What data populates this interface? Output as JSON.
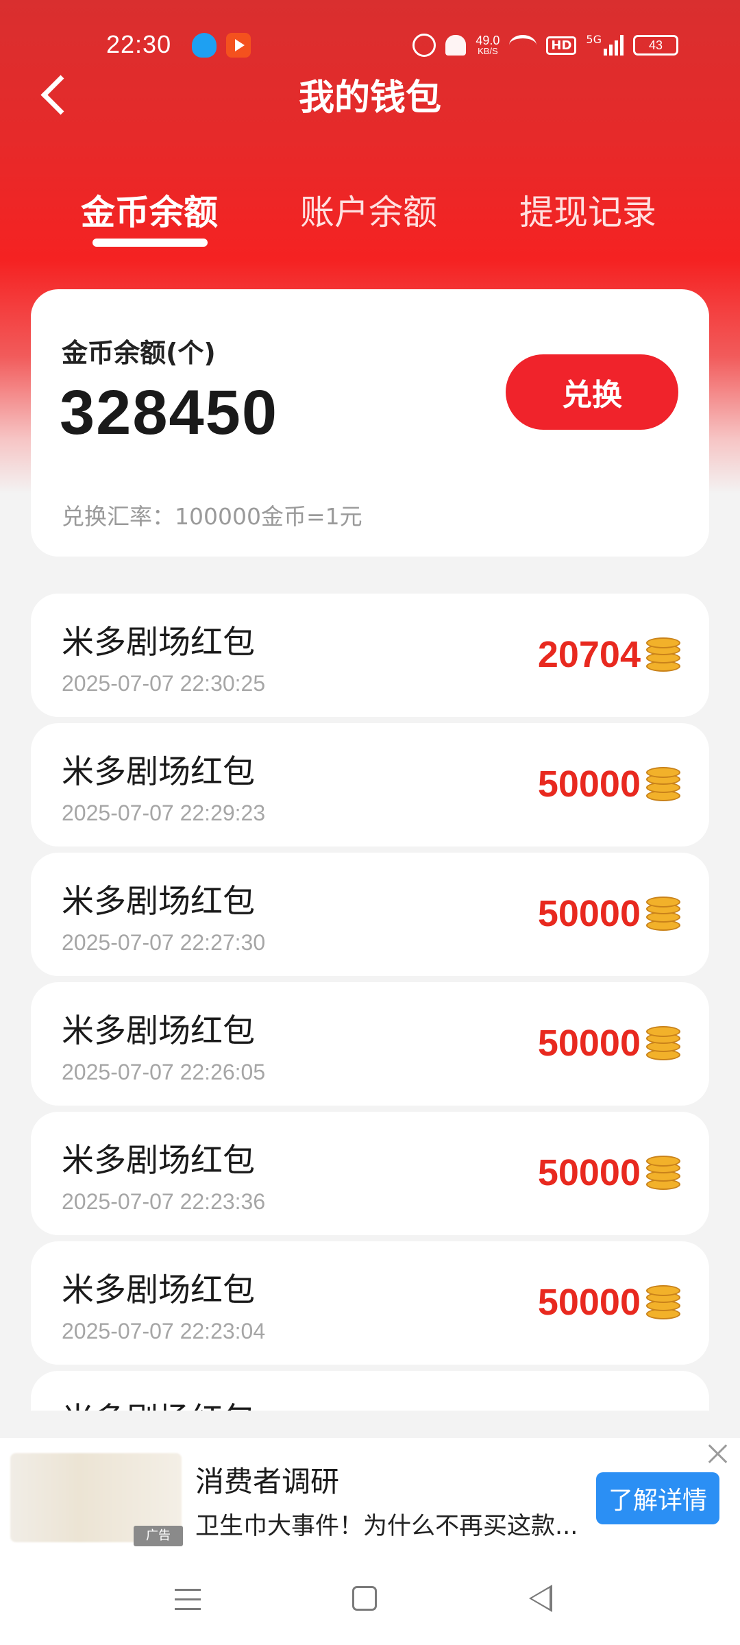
{
  "status_bar": {
    "time": "22:30",
    "net_speed_value": "49.0",
    "net_speed_unit": "KB/S",
    "hd_label": "HD",
    "network": "5G",
    "battery": "43"
  },
  "header": {
    "title": "我的钱包"
  },
  "tabs": [
    {
      "label": "金币余额",
      "active": true
    },
    {
      "label": "账户余额",
      "active": false
    },
    {
      "label": "提现记录",
      "active": false
    }
  ],
  "balance_card": {
    "label": "金币余额(个)",
    "value": "328450",
    "exchange_button": "兑换",
    "exchange_rate": "兑换汇率：100000金币=1元"
  },
  "records": [
    {
      "title": "米多剧场红包",
      "time": "2025-07-07 22:30:25",
      "amount": "20704"
    },
    {
      "title": "米多剧场红包",
      "time": "2025-07-07 22:29:23",
      "amount": "50000"
    },
    {
      "title": "米多剧场红包",
      "time": "2025-07-07 22:27:30",
      "amount": "50000"
    },
    {
      "title": "米多剧场红包",
      "time": "2025-07-07 22:26:05",
      "amount": "50000"
    },
    {
      "title": "米多剧场红包",
      "time": "2025-07-07 22:23:36",
      "amount": "50000"
    },
    {
      "title": "米多剧场红包",
      "time": "2025-07-07 22:23:04",
      "amount": "50000"
    },
    {
      "title": "米多剧场红包",
      "time": "",
      "amount": ""
    }
  ],
  "ad": {
    "tag": "广告",
    "title": "消费者调研",
    "description": "卫生巾大事件！为什么不再买这款...",
    "cta": "了解详情"
  },
  "colors": {
    "primary_red": "#f0232b",
    "amount_red": "#e8291f",
    "cta_blue": "#2b8ff4"
  }
}
